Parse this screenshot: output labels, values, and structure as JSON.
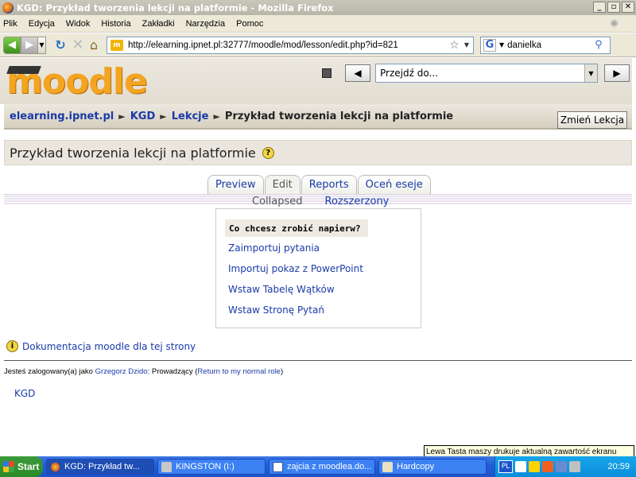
{
  "window": {
    "title": "KGD: Przykład tworzenia lekcji na platformie - Mozilla Firefox",
    "min": "_",
    "max": "▫",
    "close": "✕"
  },
  "menu": [
    "Plik",
    "Edycja",
    "Widok",
    "Historia",
    "Zakładki",
    "Narzędzia",
    "Pomoc"
  ],
  "nav": {
    "url": "http://elearning.ipnet.pl:32777/moodle/mod/lesson/edit.php?id=821",
    "favicon": "m",
    "search_engine": "G",
    "search_value": "danielka"
  },
  "moodle": {
    "logo": "moodle",
    "jump_label": "Przejdź do...",
    "prev_arrow": "◀",
    "next_arrow": "▶"
  },
  "breadcrumb": {
    "items": [
      "elearning.ipnet.pl",
      "KGD",
      "Lekcje"
    ],
    "current": "Przykład tworzenia lekcji na platformie",
    "separator": "►",
    "change_button": "Zmień Lekcja"
  },
  "page": {
    "title": "Przykład tworzenia lekcji na platformie",
    "help_icon": "?"
  },
  "tabs": [
    {
      "label": "Preview",
      "active": false
    },
    {
      "label": "Edit",
      "active": true
    },
    {
      "label": "Reports",
      "active": false
    },
    {
      "label": "Oceń eseje",
      "active": false
    }
  ],
  "subtabs": {
    "collapsed": "Collapsed",
    "expanded": "Rozszerzony"
  },
  "box": {
    "heading": "Co chcesz zrobić napierw?",
    "links": [
      "Zaimportuj pytania",
      "Importuj pokaz z PowerPoint",
      "Wstaw Tabelę Wątków",
      "Wstaw Stronę Pytań"
    ]
  },
  "footer": {
    "doc_link": "Dokumentacja moodle dla tej strony",
    "logged_prefix": "Jesteś zalogowany(a) jako ",
    "user": "Grzegorz Dzido",
    "role_text": ": Prowadzący (",
    "return_link": "Return to my normal role",
    "close_paren": ")",
    "home": "KGD"
  },
  "tooltip": "Lewa Tasta maszy drukuje aktualną zawartość ekranu",
  "taskbar": {
    "start": "Start",
    "tasks": [
      {
        "label": "KGD: Przykład tw...",
        "active": true
      },
      {
        "label": "KINGSTON (I:)",
        "active": false
      },
      {
        "label": "zajcia z moodlea.do...",
        "active": false
      },
      {
        "label": "Hardcopy",
        "active": false
      }
    ],
    "lang": "PL",
    "clock": "20:59"
  }
}
